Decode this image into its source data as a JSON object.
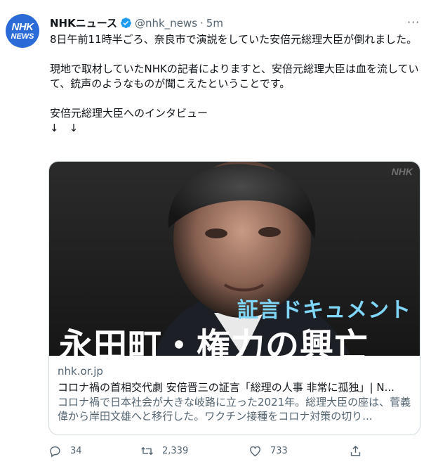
{
  "account": {
    "avatar_line1": "NHK",
    "avatar_line2": "NEWS",
    "name": "NHKニュース",
    "handle": "@nhk_news",
    "separator": "·",
    "time": "5m",
    "verified_color": "#1d9bf0"
  },
  "tweet": {
    "text": "8日午前11時半ごろ、奈良市で演説をしていた安倍元総理大臣が倒れました。\n\n現地で取材していたNHKの記者によりますと、安倍元総理大臣は血を流していて、銃声のようなものが聞こえたということです。\n\n安倍元総理大臣へのインタビュー\n↓　↓"
  },
  "card": {
    "image_watermark": "NHK",
    "image_subtitle": "証言ドキュメント",
    "image_title": "永田町・権力の興亡",
    "domain": "nhk.or.jp",
    "title": "コロナ禍の首相交代劇 安倍晋三の証言「総理の人事 非常に孤独」| N...",
    "description": "コロナ禍で日本社会が大きな岐路に立った2021年。総理大臣の座は、菅義偉から岸田文雄へと移行した。ワクチン接種をコロナ対策の切り..."
  },
  "actions": {
    "reply_count": "34",
    "retweet_count": "2,339",
    "like_count": "733"
  },
  "colors": {
    "text": "#0f1419",
    "muted": "#536471",
    "border": "#cfd9de",
    "avatar_bg": "#2a6bd8",
    "subtitle": "#7fd6f7"
  }
}
